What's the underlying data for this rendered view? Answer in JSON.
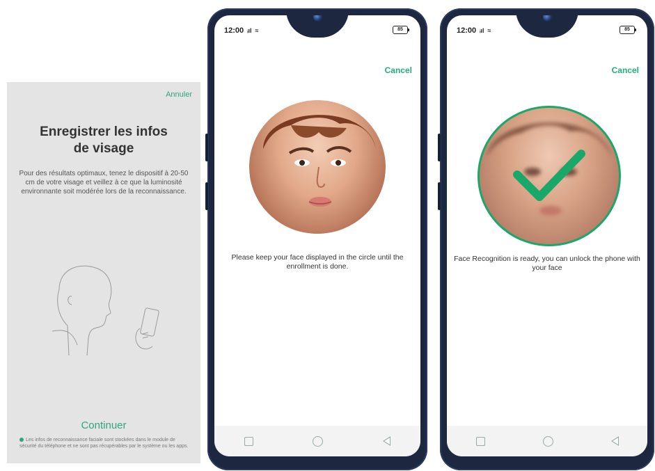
{
  "screen1": {
    "cancel": "Annuler",
    "title": "Enregistrer les infos de visage",
    "description": "Pour des résultats optimaux, tenez le dispositif à 20-50 cm de votre visage et veillez à ce que la luminosité environnante soit modérée lors de la reconnaissance.",
    "continue": "Continuer",
    "notice": "Les infos de reconnaissance faciale sont stockées dans le module de sécurité du téléphone et ne sont pas récupérables par le système ou les apps."
  },
  "screen2": {
    "time": "12:00",
    "battery": "85",
    "cancel": "Cancel",
    "instruction": "Please keep your face displayed in the circle until the enrollment is done."
  },
  "screen3": {
    "time": "12:00",
    "battery": "85",
    "cancel": "Cancel",
    "message": "Face Recognition is ready, you can unlock the phone with your face"
  },
  "colors": {
    "accent": "#22b07a",
    "check": "#19a86a",
    "phone_frame": "#1d2740"
  },
  "icons": [
    "signal-icon",
    "wifi-icon",
    "battery-icon",
    "checkmark-icon",
    "nav-recent-icon",
    "nav-home-icon",
    "nav-back-icon",
    "shield-dot-icon"
  ]
}
